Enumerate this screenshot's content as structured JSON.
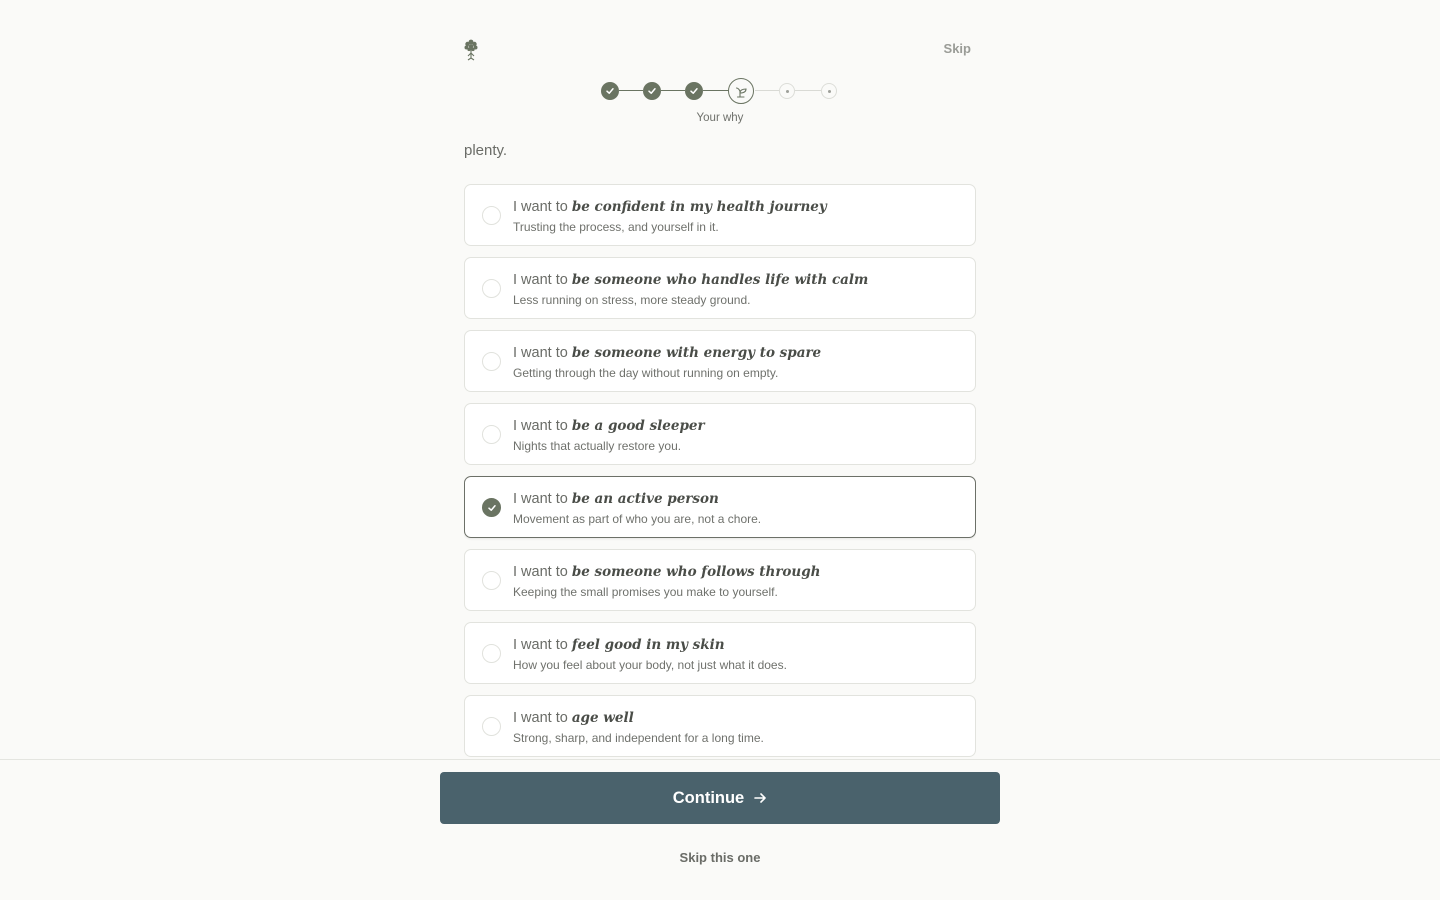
{
  "header": {
    "skip_label": "Skip",
    "steps": [
      {
        "state": "done",
        "icon": "check-icon"
      },
      {
        "state": "done",
        "icon": "check-icon"
      },
      {
        "state": "done",
        "icon": "check-icon"
      },
      {
        "state": "current",
        "icon": "sprout-icon"
      },
      {
        "state": "todo",
        "icon": "dot-icon"
      },
      {
        "state": "todo",
        "icon": "dot-icon"
      }
    ],
    "current_step_label": "Your why"
  },
  "main": {
    "lead_text": "plenty.",
    "option_prefix": "I want to",
    "options": [
      {
        "emphasis": "be confident in my health journey",
        "subtitle": "Trusting the process, and yourself in it.",
        "selected": false
      },
      {
        "emphasis": "be someone who handles life with calm",
        "subtitle": "Less running on stress, more steady ground.",
        "selected": false
      },
      {
        "emphasis": "be someone with energy to spare",
        "subtitle": "Getting through the day without running on empty.",
        "selected": false
      },
      {
        "emphasis": "be a good sleeper",
        "subtitle": "Nights that actually restore you.",
        "selected": false
      },
      {
        "emphasis": "be an active person",
        "subtitle": "Movement as part of who you are, not a chore.",
        "selected": true
      },
      {
        "emphasis": "be someone who follows through",
        "subtitle": "Keeping the small promises you make to yourself.",
        "selected": false
      },
      {
        "emphasis": "feel good in my skin",
        "subtitle": "How you feel about your body, not just what it does.",
        "selected": false
      },
      {
        "emphasis": "age well",
        "subtitle": "Strong, sharp, and independent for a long time.",
        "selected": false
      }
    ]
  },
  "footer": {
    "continue_label": "Continue",
    "skip_one_label": "Skip this one"
  },
  "colors": {
    "accent": "#6a7462",
    "button": "#4a626c",
    "background": "#fafaf8"
  }
}
